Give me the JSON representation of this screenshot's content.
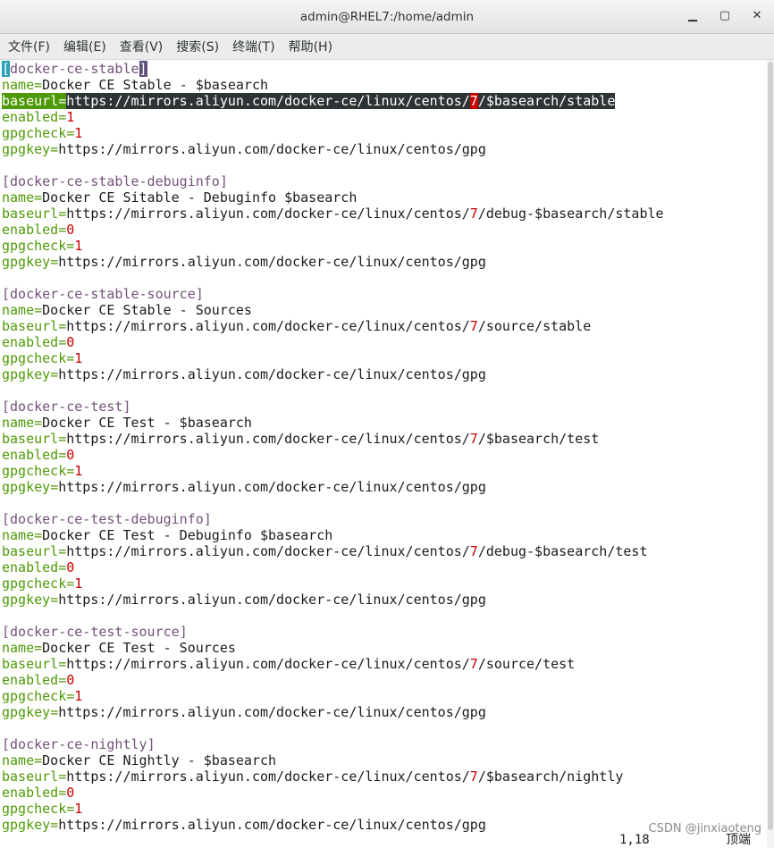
{
  "window": {
    "title": "admin@RHEL7:/home/admin",
    "minimize": "▁",
    "maximize": "▢",
    "close": "✕"
  },
  "menu": [
    "文件(F)",
    "编辑(E)",
    "查看(V)",
    "搜索(S)",
    "终端(T)",
    "帮助(H)"
  ],
  "colors": {
    "key": "#4e9a06",
    "section": "#75507b",
    "number": "#cc0000",
    "text": "#1c1c1c"
  },
  "repos": [
    {
      "section": "docker-ce-stable",
      "name": "Docker CE Stable - $basearch",
      "baseurl_prefix": "https://mirrors.aliyun.com/docker-ce/linux/centos/",
      "baseurl_ver": "7",
      "baseurl_suffix": "/$basearch/stable",
      "enabled": "1",
      "gpgcheck": "1",
      "gpgkey": "https://mirrors.aliyun.com/docker-ce/linux/centos/gpg"
    },
    {
      "section": "docker-ce-stable-debuginfo",
      "name": "Docker CE Sitable - Debuginfo $basearch",
      "baseurl_prefix": "https://mirrors.aliyun.com/docker-ce/linux/centos/",
      "baseurl_ver": "7",
      "baseurl_suffix": "/debug-$basearch/stable",
      "enabled": "0",
      "gpgcheck": "1",
      "gpgkey": "https://mirrors.aliyun.com/docker-ce/linux/centos/gpg"
    },
    {
      "section": "docker-ce-stable-source",
      "name": "Docker CE Stable - Sources",
      "baseurl_prefix": "https://mirrors.aliyun.com/docker-ce/linux/centos/",
      "baseurl_ver": "7",
      "baseurl_suffix": "/source/stable",
      "enabled": "0",
      "gpgcheck": "1",
      "gpgkey": "https://mirrors.aliyun.com/docker-ce/linux/centos/gpg"
    },
    {
      "section": "docker-ce-test",
      "name": "Docker CE Test - $basearch",
      "baseurl_prefix": "https://mirrors.aliyun.com/docker-ce/linux/centos/",
      "baseurl_ver": "7",
      "baseurl_suffix": "/$basearch/test",
      "enabled": "0",
      "gpgcheck": "1",
      "gpgkey": "https://mirrors.aliyun.com/docker-ce/linux/centos/gpg"
    },
    {
      "section": "docker-ce-test-debuginfo",
      "name": "Docker CE Test - Debuginfo $basearch",
      "baseurl_prefix": "https://mirrors.aliyun.com/docker-ce/linux/centos/",
      "baseurl_ver": "7",
      "baseurl_suffix": "/debug-$basearch/test",
      "enabled": "0",
      "gpgcheck": "1",
      "gpgkey": "https://mirrors.aliyun.com/docker-ce/linux/centos/gpg"
    },
    {
      "section": "docker-ce-test-source",
      "name": "Docker CE Test - Sources",
      "baseurl_prefix": "https://mirrors.aliyun.com/docker-ce/linux/centos/",
      "baseurl_ver": "7",
      "baseurl_suffix": "/source/test",
      "enabled": "0",
      "gpgcheck": "1",
      "gpgkey": "https://mirrors.aliyun.com/docker-ce/linux/centos/gpg"
    },
    {
      "section": "docker-ce-nightly",
      "name": "Docker CE Nightly - $basearch",
      "baseurl_prefix": "https://mirrors.aliyun.com/docker-ce/linux/centos/",
      "baseurl_ver": "7",
      "baseurl_suffix": "/$basearch/nightly",
      "enabled": "0",
      "gpgcheck": "1",
      "gpgkey": "https://mirrors.aliyun.com/docker-ce/linux/centos/gpg"
    }
  ],
  "labels": {
    "name": "name",
    "baseurl": "baseurl",
    "enabled": "enabled",
    "gpgcheck": "gpgcheck",
    "gpgkey": "gpgkey",
    "eq": "="
  },
  "status": {
    "position": "1,18",
    "scroll": "顶端"
  },
  "watermark": "CSDN @jinxiaoteng"
}
